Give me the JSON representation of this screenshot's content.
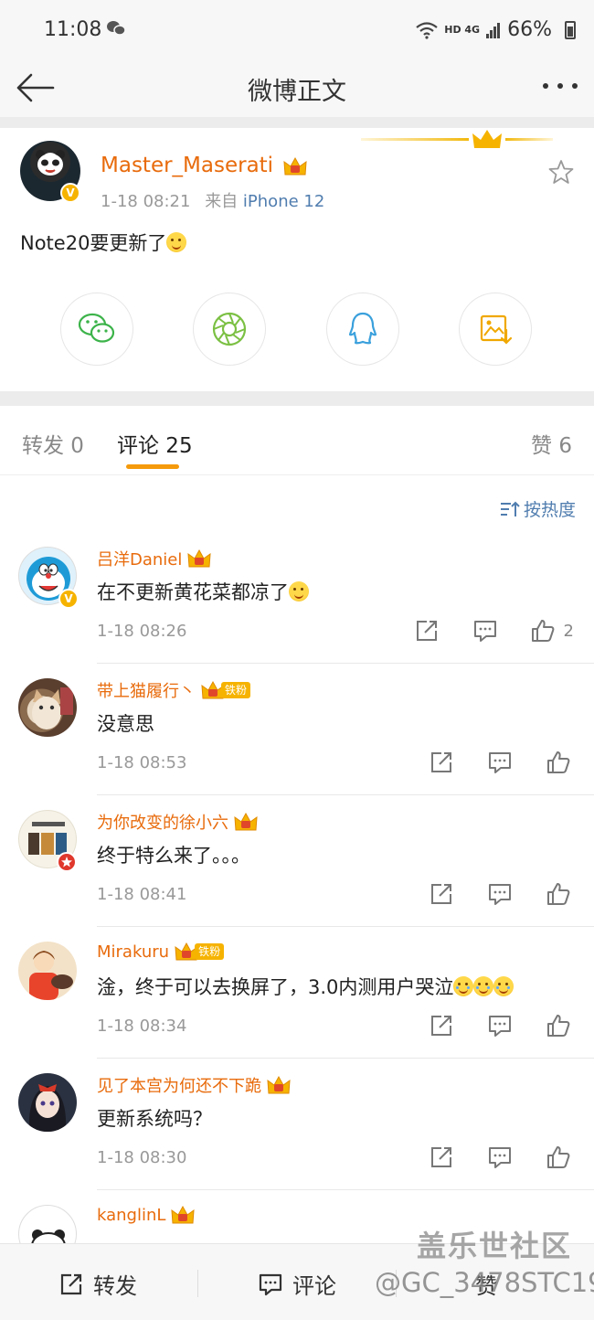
{
  "status_bar": {
    "time": "11:08",
    "network": "HD 4G",
    "battery": "66%"
  },
  "nav": {
    "title": "微博正文"
  },
  "post": {
    "username": "Master_Maserati",
    "time": "1-18 08:21",
    "source_prefix": "来自",
    "source": "iPhone 12",
    "text": "Note20要更新了"
  },
  "share_icons": [
    "wechat-icon",
    "moments-icon",
    "qq-icon",
    "save-image-icon"
  ],
  "tabs": {
    "repost": "转发 0",
    "comments": "评论 25",
    "likes": "赞 6"
  },
  "sort_label": "按热度",
  "comments": [
    {
      "name": "吕洋Daniel",
      "text": "在不更新黄花菜都凉了",
      "time": "1-18 08:26",
      "likes": "2"
    },
    {
      "name": "带上猫履行丶",
      "badge": "铁粉",
      "text": "没意思",
      "time": "1-18 08:53"
    },
    {
      "name": "为你改变的徐小六",
      "text": "终于特么来了。。。",
      "time": "1-18 08:41"
    },
    {
      "name": "Mirakuru",
      "badge": "铁粉",
      "text": "淦，终于可以去换屏了，3.0内测用户哭泣",
      "time": "1-18 08:34"
    },
    {
      "name": "见了本宫为何还不下跪",
      "text": "更新系统吗？",
      "time": "1-18 08:30"
    },
    {
      "name": "kanglinL"
    }
  ],
  "bottom_bar": {
    "repost": "转发",
    "comment": "评论",
    "like": "赞"
  },
  "watermark": {
    "site": "盖乐世社区",
    "user": "@GC_3478STC19"
  },
  "colors": {
    "username": "#e86b0c",
    "link": "#507daf",
    "accent": "#f59a0b"
  }
}
